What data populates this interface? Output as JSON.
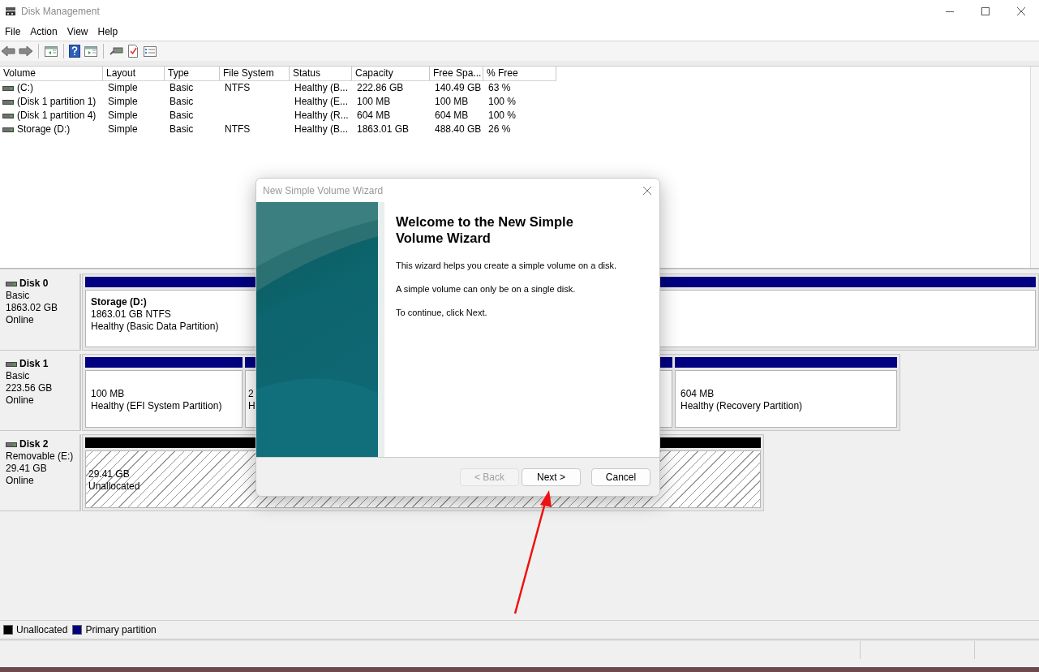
{
  "window": {
    "title": "Disk Management"
  },
  "menu": [
    "File",
    "Action",
    "View",
    "Help"
  ],
  "volumes": {
    "columns": [
      "Volume",
      "Layout",
      "Type",
      "File System",
      "Status",
      "Capacity",
      "Free Spa...",
      "% Free"
    ],
    "rows": [
      [
        "(C:)",
        "Simple",
        "Basic",
        "NTFS",
        "Healthy (B...",
        "222.86 GB",
        "140.49 GB",
        "63 %"
      ],
      [
        "(Disk 1 partition 1)",
        "Simple",
        "Basic",
        "",
        "Healthy (E...",
        "100 MB",
        "100 MB",
        "100 %"
      ],
      [
        "(Disk 1 partition 4)",
        "Simple",
        "Basic",
        "",
        "Healthy (R...",
        "604 MB",
        "604 MB",
        "100 %"
      ],
      [
        "Storage (D:)",
        "Simple",
        "Basic",
        "NTFS",
        "Healthy (B...",
        "1863.01 GB",
        "488.40 GB",
        "26 %"
      ]
    ]
  },
  "disks": [
    {
      "name": "Disk 0",
      "type": "Basic",
      "size": "1863.02 GB",
      "status": "Online",
      "partitions": [
        {
          "kind": "primary",
          "title": "Storage  (D:)",
          "lines": [
            "1863.01 GB NTFS",
            "Healthy (Basic Data Partition)"
          ]
        }
      ]
    },
    {
      "name": "Disk 1",
      "type": "Basic",
      "size": "223.56 GB",
      "status": "Online",
      "partitions": [
        {
          "kind": "primary",
          "lines": [
            "100 MB",
            "Healthy (EFI System Partition)"
          ]
        },
        {
          "kind": "primary",
          "lines": [
            "2",
            "H"
          ]
        },
        {
          "kind": "primary",
          "lines": [
            "604 MB",
            "Healthy (Recovery Partition)"
          ]
        }
      ]
    },
    {
      "name": "Disk 2",
      "type": "Removable (E:)",
      "size": "29.41 GB",
      "status": "Online",
      "partitions": [
        {
          "kind": "unallocated",
          "lines": [
            "29.41 GB",
            "Unallocated"
          ]
        }
      ]
    }
  ],
  "legend": [
    {
      "label": "Unallocated",
      "color": "#000000"
    },
    {
      "label": "Primary partition",
      "color": "#000080"
    }
  ],
  "wizard": {
    "title": "New Simple Volume Wizard",
    "heading": "Welcome to the New Simple Volume Wizard",
    "paragraphs": [
      "This wizard helps you create a simple volume on a disk.",
      "A simple volume can only be on a single disk.",
      "To continue, click Next."
    ],
    "buttons": [
      {
        "label": "< Back",
        "disabled": true
      },
      {
        "label": "Next >",
        "disabled": false
      },
      {
        "label": "Cancel",
        "disabled": false
      }
    ]
  }
}
